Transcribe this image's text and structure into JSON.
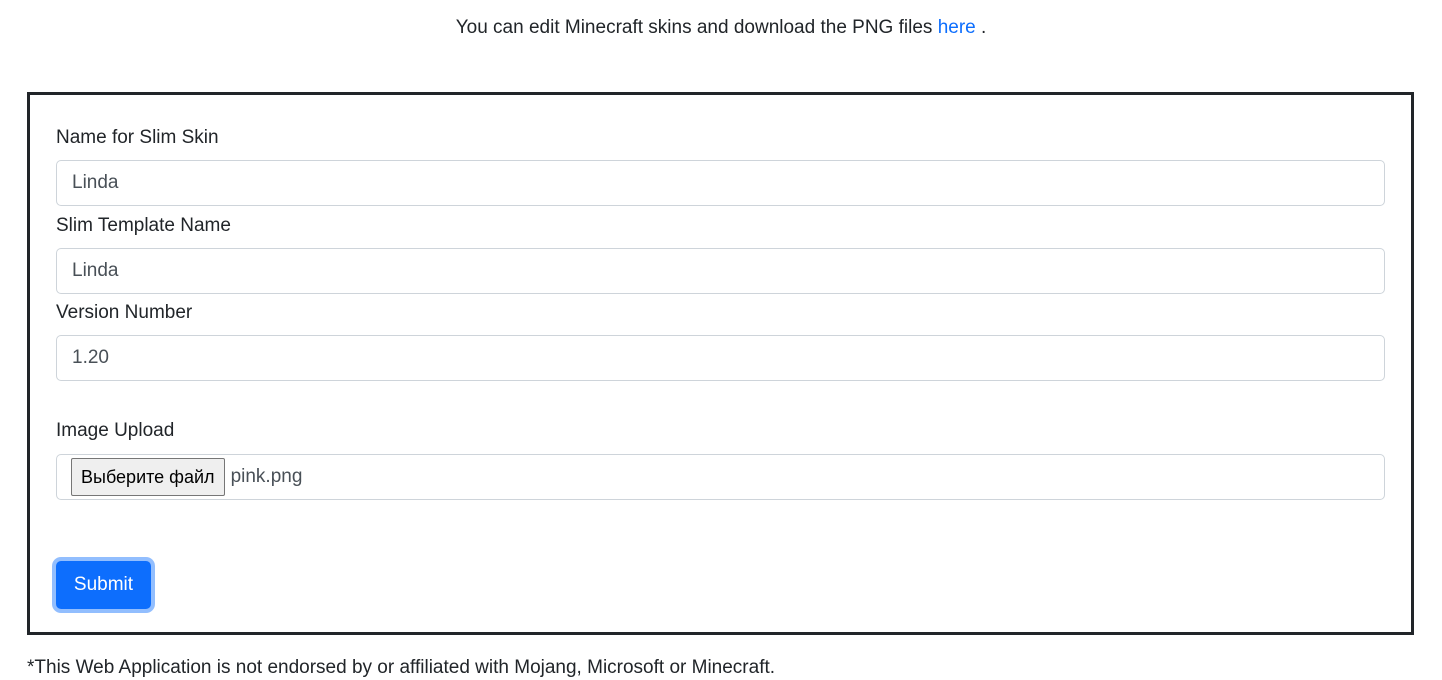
{
  "intro": {
    "text": "You can edit Minecraft skins and download the PNG files ",
    "link_label": "here",
    "after": " ."
  },
  "form": {
    "skin_name": {
      "label": "Name for Slim Skin",
      "value": "Linda"
    },
    "template_name": {
      "label": "Slim Template Name",
      "value": "Linda"
    },
    "version": {
      "label": "Version Number",
      "value": "1.20"
    },
    "image_upload": {
      "label": "Image Upload",
      "button_label": "Выберите файл",
      "file_name": "pink.png"
    },
    "submit_label": "Submit"
  },
  "footer": {
    "text": "*This Web Application is not endorsed by or affiliated with Mojang, Microsoft or Minecraft."
  },
  "colors": {
    "accent": "#0d6efd",
    "border": "#212529"
  }
}
